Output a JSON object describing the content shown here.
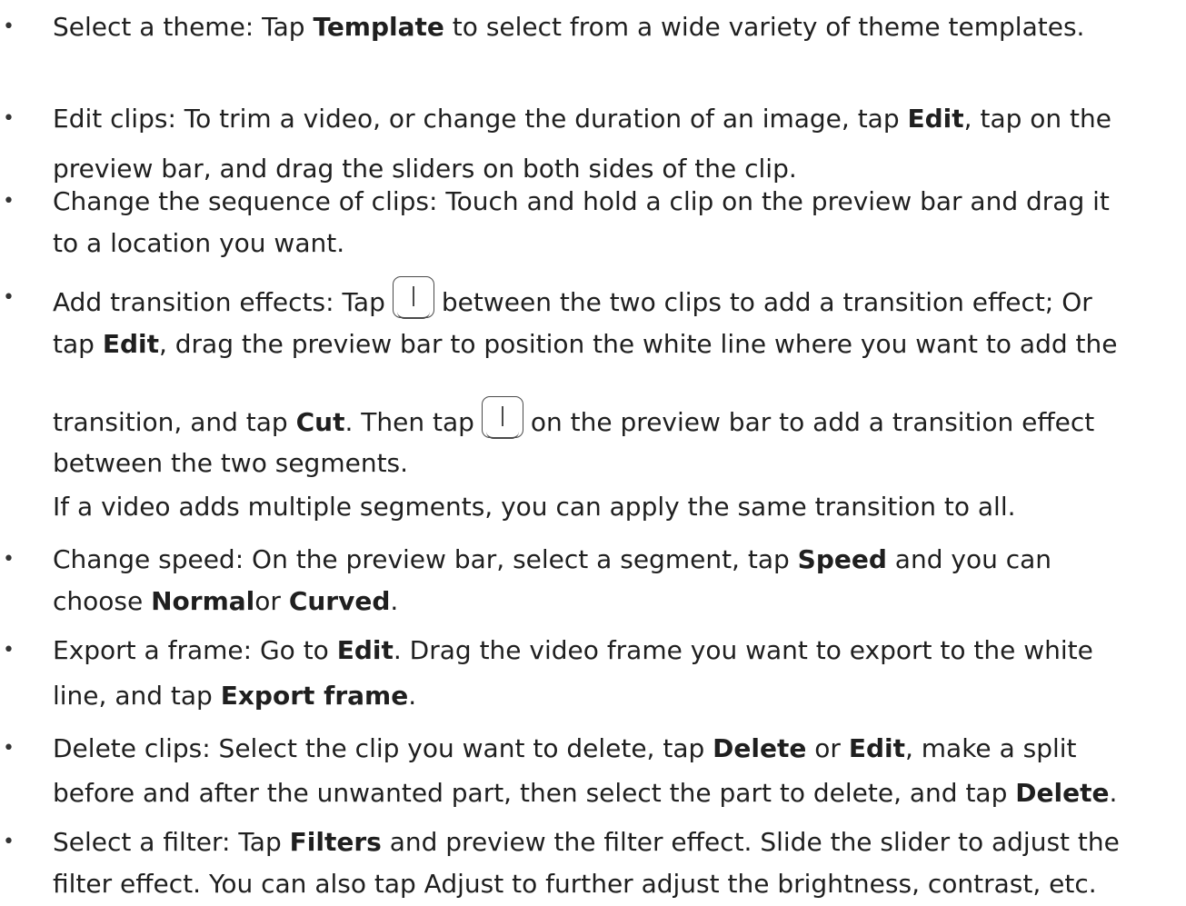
{
  "items": [
    {
      "lines": [
        [
          "Select a theme: Tap ",
          {
            "b": "Template"
          },
          " to select from a wide variety of theme templates."
        ]
      ]
    },
    {
      "lines": [
        [
          "Edit clips: To trim a video, or change the duration of an image, tap ",
          {
            "b": "Edit"
          },
          ", tap on the"
        ],
        [
          "preview bar, and drag the sliders on both sides of the clip."
        ]
      ]
    },
    {
      "lines": [
        [
          "Change the sequence of clips: Touch and hold a clip on the preview bar and drag it"
        ],
        [
          "to a location you want."
        ]
      ]
    },
    {
      "lines": [
        [
          "Add transition effects: Tap",
          {
            "icon": "transition-button-icon"
          },
          "between the two clips to add a transition effect; Or"
        ],
        [
          "tap ",
          {
            "b": "Edit"
          },
          ", drag the preview bar to position the white line where you want to add the"
        ],
        [
          "transition, and tap ",
          {
            "b": "Cut"
          },
          ". Then tap",
          {
            "icon": "transition-button-icon"
          },
          "on the preview bar to add a transition effect"
        ],
        [
          "between the two segments."
        ],
        [
          "If a video adds multiple segments, you can apply the same transition to all."
        ]
      ]
    },
    {
      "lines": [
        [
          "Change speed: On the preview bar, select a segment, tap ",
          {
            "b": "Speed"
          },
          " and you can"
        ],
        [
          "choose ",
          {
            "b": "Normal"
          },
          "or ",
          {
            "b": "Curved"
          },
          "."
        ]
      ]
    },
    {
      "lines": [
        [
          "Export a frame: Go to ",
          {
            "b": "Edit"
          },
          ". Drag the video frame you want to export to the white"
        ],
        [
          "line, and tap ",
          {
            "b": "Export frame"
          },
          "."
        ]
      ]
    },
    {
      "lines": [
        [
          "Delete clips: Select the clip you want to delete, tap ",
          {
            "b": "Delete"
          },
          " or ",
          {
            "b": "Edit"
          },
          ", make a split"
        ],
        [
          "before and after the unwanted part, then select the part to delete, and tap ",
          {
            "b": "Delete"
          },
          "."
        ]
      ]
    },
    {
      "lines": [
        [
          "Select a filter: Tap ",
          {
            "b": "Filters"
          },
          " and preview the filter effect. Slide the slider to adjust the"
        ],
        [
          "filter effect. You can also tap Adjust to further adjust the brightness, contrast, etc."
        ]
      ]
    }
  ],
  "bullet_char": "•",
  "colors": {
    "text": "#1f1f1f",
    "background": "#ffffff",
    "icon_stroke": "#4a4a4a"
  }
}
